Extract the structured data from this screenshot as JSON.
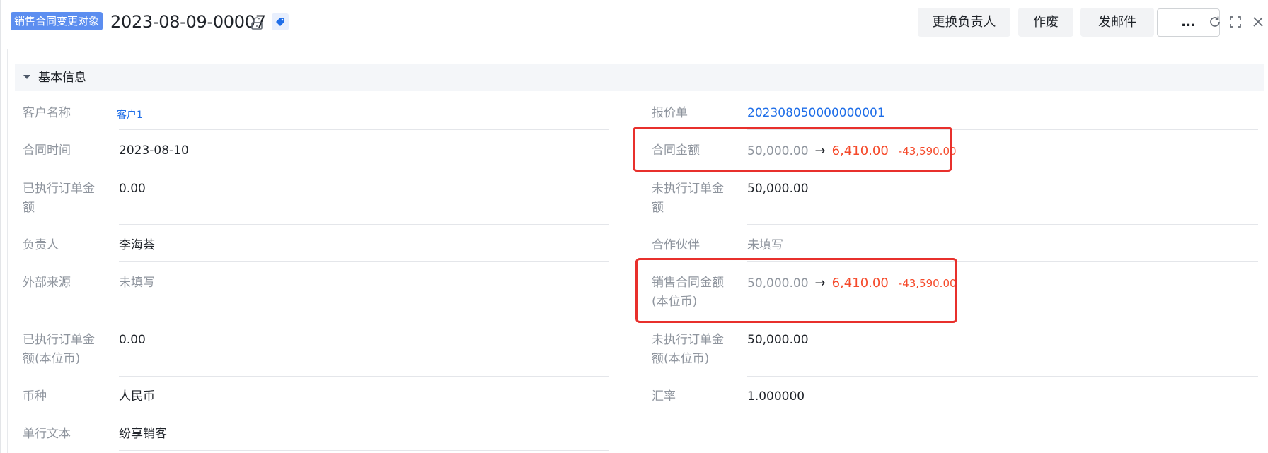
{
  "header": {
    "object_tag": "销售合同变更对象",
    "record_id": "2023-08-09-00007",
    "lock_icon": "lock-open-icon",
    "tag_icon": "tag-icon",
    "buttons": {
      "change_owner": "更换负责人",
      "void": "作废",
      "send_email": "发邮件",
      "more": "..."
    },
    "controls": [
      "refresh-icon",
      "expand-icon",
      "close-icon"
    ]
  },
  "section": {
    "title": "基本信息"
  },
  "left_fields": [
    {
      "label": "客户名称",
      "value": "客户1"
    },
    {
      "label": "合同时间",
      "value": "2023-08-10"
    },
    {
      "label_line1": "已执行订单金",
      "label_line2": "额",
      "value": "0.00"
    },
    {
      "label": "负责人",
      "value": "李海荟"
    },
    {
      "label": "外部来源",
      "value": "未填写"
    },
    {
      "label_line1": "已执行订单金",
      "label_line2": "额(本位币)",
      "value": "0.00"
    },
    {
      "label": "币种",
      "value": "人民币"
    },
    {
      "label": "单行文本",
      "value": "纷享销客"
    }
  ],
  "right_fields": [
    {
      "label": "报价单",
      "value": "202308050000000001"
    },
    {
      "label": "合同金额",
      "old_value": "50,000.00",
      "arrow": "→",
      "new_value": "6,410.00",
      "diff": "-43,590.00"
    },
    {
      "label_line1": "未执行订单金",
      "label_line2": "额",
      "value": "50,000.00"
    },
    {
      "label": "合作伙伴",
      "value": "未填写"
    },
    {
      "label_line1": "销售合同金额",
      "label_line2": "(本位币)",
      "old_value": "50,000.00",
      "arrow": "→",
      "new_value": "6,410.00",
      "diff": "-43,590.00"
    },
    {
      "label_line1": "未执行订单金",
      "label_line2": "额(本位币)",
      "value": "50,000.00"
    },
    {
      "label": "汇率",
      "value": "1.000000"
    }
  ],
  "colors": {
    "tag_bg": "#5c8ef0",
    "link": "#1f6ee8",
    "changed_value": "#f54a2b",
    "highlight_box": "#e8302c",
    "label": "#8f959e"
  }
}
